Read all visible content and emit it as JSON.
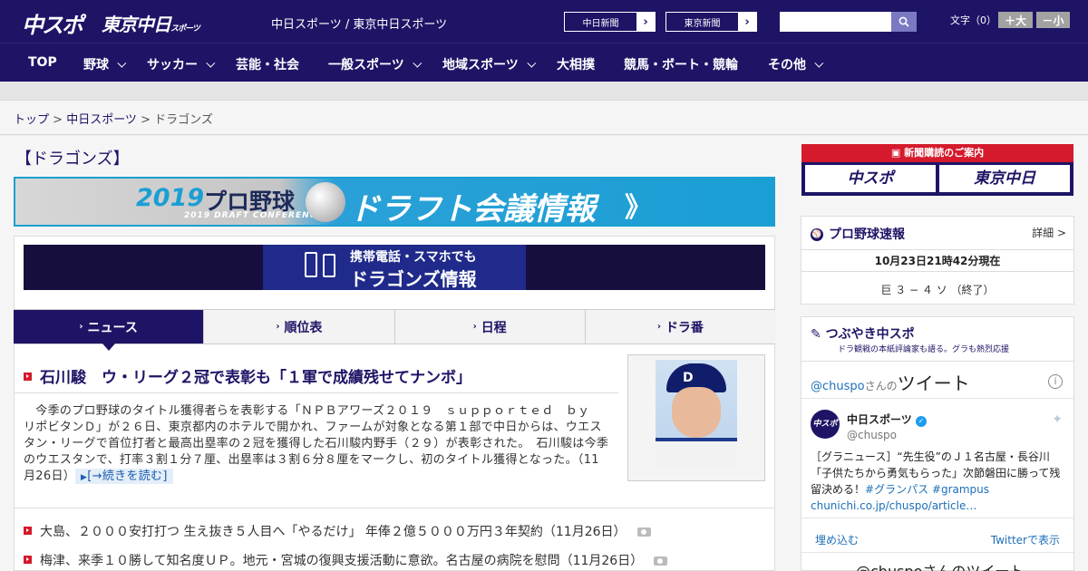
{
  "header": {
    "logo_chuspo": "中スポ",
    "logo_tokyo": "東京中日",
    "logo_tokyo_small": "スポーツ",
    "site_title": "中日スポーツ / 東京中日スポーツ",
    "paper_links": [
      "中日新聞",
      "東京新聞"
    ],
    "search_placeholder": "",
    "font_size_label": "文字（0）",
    "font_bigger": "＋大",
    "font_smaller": "－小"
  },
  "nav": {
    "items": [
      {
        "label": "TOP",
        "has_dropdown": false
      },
      {
        "label": "野球",
        "has_dropdown": true
      },
      {
        "label": "サッカー",
        "has_dropdown": true
      },
      {
        "label": "芸能・社会",
        "has_dropdown": false
      },
      {
        "label": "一般スポーツ",
        "has_dropdown": true
      },
      {
        "label": "地域スポーツ",
        "has_dropdown": true
      },
      {
        "label": "大相撲",
        "has_dropdown": false
      },
      {
        "label": "競馬・ボート・競輪",
        "has_dropdown": false
      },
      {
        "label": "その他",
        "has_dropdown": true
      }
    ]
  },
  "breadcrumb": {
    "items": [
      "トップ",
      "中日スポーツ",
      "ドラゴンズ"
    ],
    "separator": " > "
  },
  "section_title": "【ドラゴンズ】",
  "draft_banner": {
    "year": "2019",
    "pro": "プロ野球",
    "sub": "2019 DRAFT CONFERENCE",
    "main": "ドラフト会議情報",
    "arrow": "》"
  },
  "mobile_banner": {
    "line1": "携帯電話・スマホでも",
    "line2": "ドラゴンズ情報"
  },
  "tabs": [
    {
      "label": "ニュース",
      "active": true
    },
    {
      "label": "順位表",
      "active": false
    },
    {
      "label": "日程",
      "active": false
    },
    {
      "label": "ドラ番",
      "active": false
    }
  ],
  "top_story": {
    "headline": "石川駿　ウ・リーグ２冠で表彰も「１軍で成績残せてナンボ」",
    "lead": "　今季のプロ野球のタイトル獲得者らを表彰する「ＮＰＢアワーズ２０１９　ｓｕｐｐｏｒｔｅｄ　ｂｙ　リポビタンＤ」が２６日、東京都内のホテルで開かれ、ファームが対象となる第１部で中日からは、ウエスタン・リーグで首位打者と最高出塁率の２冠を獲得した石川駿内野手（２９）が表彰された。　石川駿は今季のウエスタンで、打率３割１分７厘、出塁率は３割６分８厘をマークし、初のタイトル獲得となった。（11月26日）",
    "read_more": "[→続きを読む]",
    "cap_logo": "D"
  },
  "news_list": [
    {
      "title": "大島、２０００安打打つ 生え抜き５人目へ「やるだけ」 年俸２億５０００万円３年契約（11月26日）",
      "has_photo": true
    },
    {
      "title": "梅津、来季１０勝して知名度ＵＰ。地元・宮城の復興支援活動に意欲。名古屋の病院を慰問（11月26日）",
      "has_photo": true
    }
  ],
  "sidebar": {
    "subscribe_header": "新聞購読のご案内",
    "subscribe_buttons": [
      "中スポ",
      "東京中日"
    ],
    "score": {
      "title": "プロ野球速報",
      "detail": "詳細 >",
      "timestamp": "10月23日21時42分現在",
      "result": "巨 ３ − ４ ソ （終了）"
    },
    "tweets_promo": {
      "title": "つぶやき中スポ",
      "subtitle": "ドラ観戦の本紙評論家も語る。グラも熱烈応援"
    },
    "twitter": {
      "handle_prefix": "@chuspo",
      "handle_suffix": "さんの",
      "tweet_word": "ツイート",
      "account_name": "中日スポーツ",
      "account_handle": "@chuspo",
      "avatar_text": "中スポ",
      "tweet_text": "［グラニュース］“先生役”のＪ１名古屋・長谷川「子供たちから勇気もらった」次節磐田に勝って残留決める！",
      "hashtags": [
        "#グランパス",
        "#grampus"
      ],
      "link": "chunichi.co.jp/chuspo/article…",
      "embed": "埋め込む",
      "view_on_twitter": "Twitterで表示",
      "footer": "@chuspoさんのツイート"
    }
  }
}
